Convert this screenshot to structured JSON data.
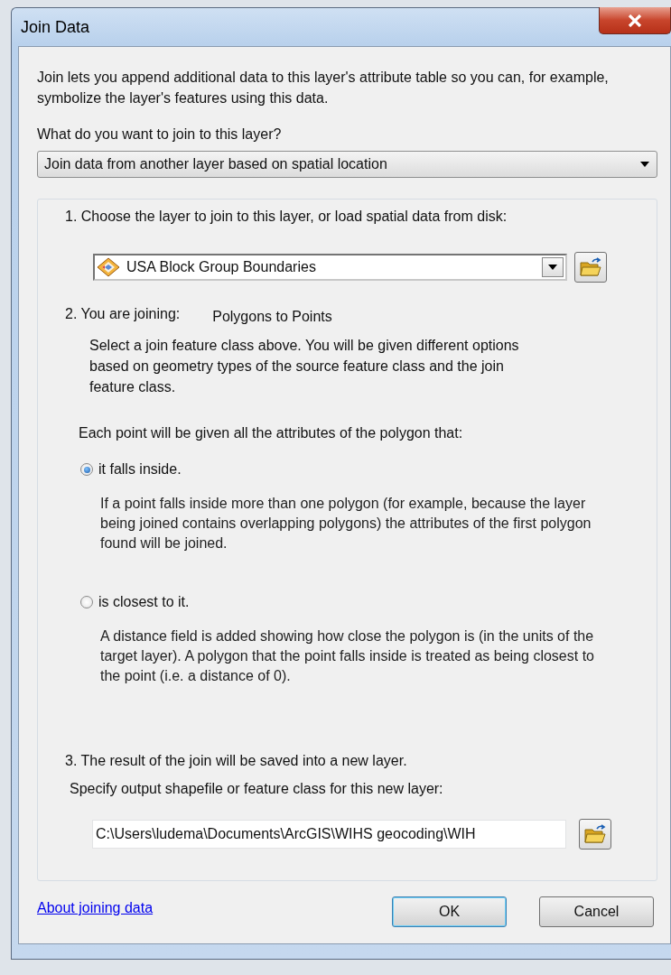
{
  "window": {
    "title": "Join Data"
  },
  "intro": "Join lets you append additional data to this layer's attribute table so you can, for example, symbolize the layer's features using this data.",
  "question": "What do you want to join to this layer?",
  "join_type": {
    "value": "Join data from another layer based on spatial location"
  },
  "step1": {
    "number": "1.",
    "label": "Choose the layer to join to this layer, or load spatial data from disk:",
    "layer": {
      "value": "USA Block Group Boundaries"
    }
  },
  "step2": {
    "number": "2.",
    "label": "You are joining:",
    "value": "Polygons to Points",
    "description": "Select a join feature class above.  You will be given different options based on geometry types of the source feature class and the join feature class.",
    "prompt": "Each point will be given all the attributes of the polygon that:",
    "options": [
      {
        "label": "it falls inside.",
        "selected": true,
        "description": "If a point falls inside more than one polygon (for example, because the layer being joined contains overlapping polygons) the attributes of the first polygon found will be joined."
      },
      {
        "label": "is closest to it.",
        "selected": false,
        "description": "A distance field is added showing how close the polygon is (in the units of the target layer). A polygon that the point falls inside is treated as being closest to the point (i.e. a distance of 0)."
      }
    ]
  },
  "step3": {
    "number": "3.",
    "label": "The result of the join will be saved into a new layer.",
    "prompt": "Specify output shapefile or feature class for this new layer:",
    "path": {
      "value": "C:\\Users\\ludema\\Documents\\ArcGIS\\WIHS geocoding\\WIH"
    }
  },
  "footer": {
    "link": "About joining data",
    "buttons": [
      {
        "label": "OK",
        "default": true
      },
      {
        "label": "Cancel",
        "default": false
      }
    ]
  }
}
